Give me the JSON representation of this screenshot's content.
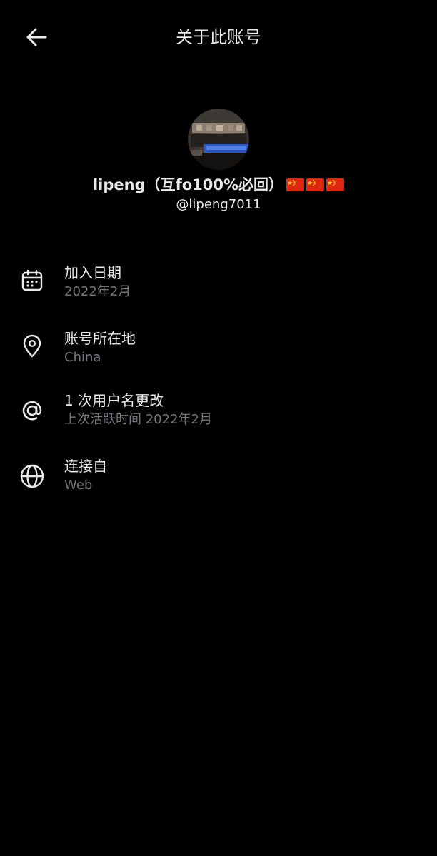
{
  "header": {
    "title": "关于此账号"
  },
  "profile": {
    "display_name": "lipeng（互fo100%必回）",
    "flag_emoji": "🇨🇳🇨🇳🇨🇳",
    "handle": "@lipeng7011"
  },
  "info": [
    {
      "icon": "calendar-icon",
      "label": "加入日期",
      "value": "2022年2月"
    },
    {
      "icon": "location-pin-icon",
      "label": "账号所在地",
      "value": "China"
    },
    {
      "icon": "at-sign-icon",
      "label": "1 次用户名更改",
      "value": "上次活跃时间 2022年2月"
    },
    {
      "icon": "globe-icon",
      "label": "连接自",
      "value": "Web"
    }
  ],
  "colors": {
    "background": "#000000",
    "primary_text": "#e7e9ea",
    "secondary_text": "#71767b",
    "flag_red": "#de2910",
    "flag_yellow": "#ffde00"
  }
}
